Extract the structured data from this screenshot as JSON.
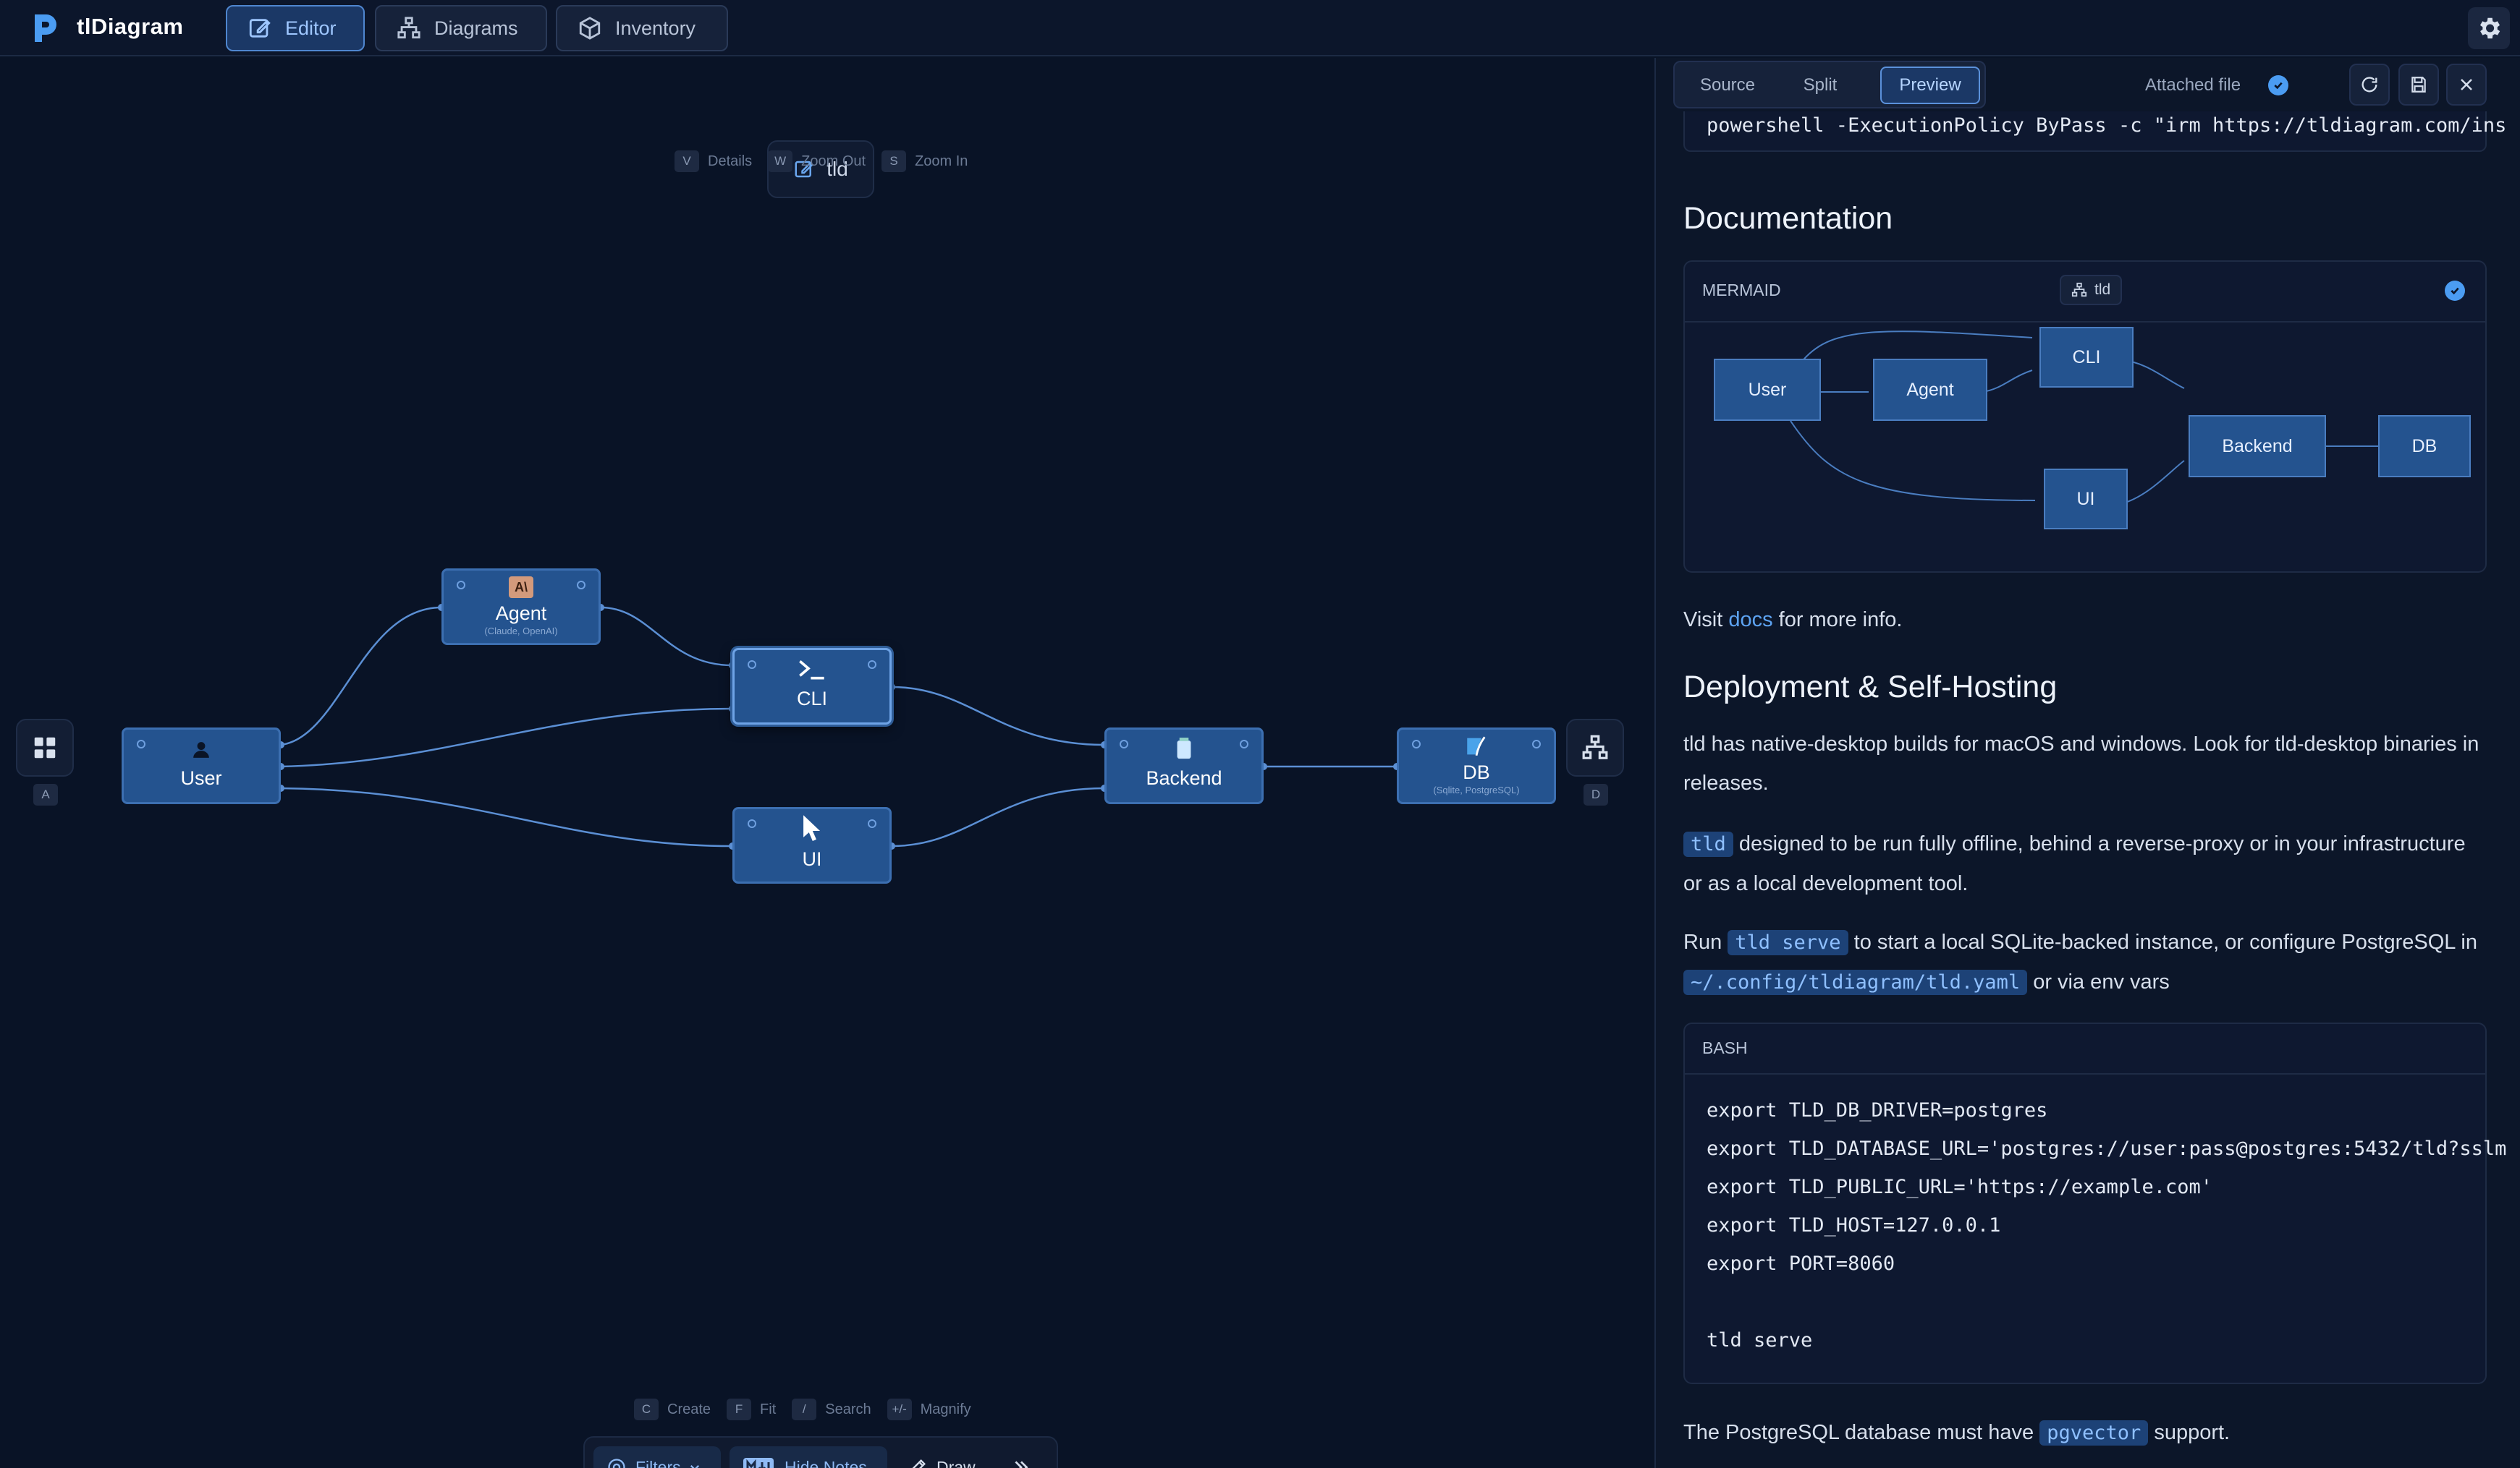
{
  "app": {
    "title": "tlDiagram"
  },
  "nav": {
    "tabs": [
      {
        "label": "Editor",
        "active": true
      },
      {
        "label": "Diagrams",
        "active": false
      },
      {
        "label": "Inventory",
        "active": false
      }
    ]
  },
  "canvas": {
    "title": "tld",
    "top_hints": [
      {
        "key": "V",
        "label": "Details"
      },
      {
        "key": "W",
        "label": "Zoom Out"
      },
      {
        "key": "S",
        "label": "Zoom In"
      }
    ],
    "left_key": "A",
    "right_key": "D",
    "nodes": {
      "user": {
        "label": "User"
      },
      "agent": {
        "label": "Agent",
        "sub": "(Claude, OpenAI)"
      },
      "cli": {
        "label": "CLI"
      },
      "ui": {
        "label": "UI"
      },
      "backend": {
        "label": "Backend"
      },
      "db": {
        "label": "DB",
        "sub": "(Sqlite, PostgreSQL)"
      }
    },
    "bottom_hints": [
      {
        "key": "C",
        "label": "Create"
      },
      {
        "key": "F",
        "label": "Fit"
      },
      {
        "key": "/",
        "label": "Search"
      },
      {
        "key": "+/-",
        "label": "Magnify"
      }
    ],
    "toolbar": {
      "filters": "Filters",
      "notes": "Hide Notes",
      "draw": "Draw"
    }
  },
  "panel": {
    "tabs": [
      {
        "label": "Source",
        "active": false
      },
      {
        "label": "Split",
        "active": false
      },
      {
        "label": "Preview",
        "active": true
      }
    ],
    "attached_label": "Attached file",
    "top_code": "powershell -ExecutionPolicy ByPass -c \"irm https://tldiagram.com/ins",
    "documentation_heading": "Documentation",
    "mermaid": {
      "header": "MERMAID",
      "chip": "tld",
      "nodes": {
        "user": "User",
        "agent": "Agent",
        "cli": "CLI",
        "ui": "UI",
        "backend": "Backend",
        "db": "DB"
      }
    },
    "visit": {
      "before": "Visit ",
      "link": "docs",
      "after": " for more info."
    },
    "deploy_heading": "Deployment & Self-Hosting",
    "para1": "tld has native-desktop builds for macOS and windows. Look for tld-desktop binaries in releases.",
    "para2": {
      "code": "tld",
      "text": " designed to be run fully offline, behind a reverse-proxy or in your infrastructure or as a local development tool."
    },
    "para3": {
      "t1": "Run ",
      "code1": "tld serve",
      "t2": " to start a local SQLite-backed instance, or configure PostgreSQL in ",
      "code2": "~/.config/tldiagram/tld.yaml",
      "t3": " or via env vars"
    },
    "bash": {
      "header": "BASH",
      "lines": [
        "export TLD_DB_DRIVER=postgres",
        "export TLD_DATABASE_URL='postgres://user:pass@postgres:5432/tld?sslm",
        "export TLD_PUBLIC_URL='https://example.com'",
        "export TLD_HOST=127.0.0.1",
        "export PORT=8060",
        "",
        "tld serve"
      ]
    },
    "final": {
      "before": "The PostgreSQL database must have ",
      "code": "pgvector",
      "after": " support."
    }
  },
  "colors": {
    "background": "#091326",
    "node_fill": "#24538f",
    "node_border": "#3c6fb1",
    "accent": "#4b9cf2",
    "inline_code_bg": "#1d4277",
    "inline_code_text": "#8fc0ff"
  }
}
